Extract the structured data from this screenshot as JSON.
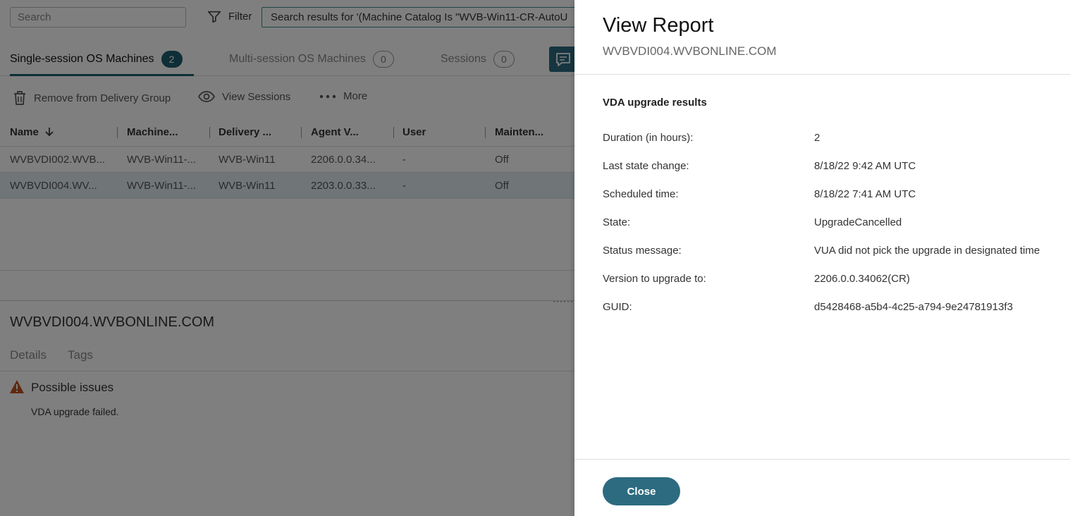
{
  "colors": {
    "accent": "#2d6b80",
    "tab_active": "#1d5e6e",
    "warning": "#c0521f",
    "row_selected": "#e0ecef"
  },
  "toolbar": {
    "search_placeholder": "Search",
    "filter_icon": "filter-icon",
    "filter_label": "Filter",
    "filter_query": "Search results for '(Machine Catalog Is \"WVB-Win11-CR-AutoU"
  },
  "tabs": [
    {
      "label": "Single-session OS Machines",
      "count": "2",
      "active": true
    },
    {
      "label": "Multi-session OS Machines",
      "count": "0",
      "active": false
    },
    {
      "label": "Sessions",
      "count": "0",
      "active": false
    }
  ],
  "actions": [
    {
      "label": "Remove from Delivery Group",
      "icon": "trash-icon"
    },
    {
      "label": "View Sessions",
      "icon": "eye-icon"
    },
    {
      "label": "More",
      "icon": "more-dots-icon"
    }
  ],
  "table": {
    "columns": [
      "Name",
      "Machine...",
      "Delivery ...",
      "Agent V...",
      "User",
      "Mainten..."
    ],
    "rows": [
      [
        "WVBVDI002.WVB...",
        "WVB-Win11-...",
        "WVB-Win11",
        "2206.0.0.34...",
        "-",
        "Off"
      ],
      [
        "WVBVDI004.WV...",
        "WVB-Win11-...",
        "WVB-Win11",
        "2203.0.0.33...",
        "-",
        "Off"
      ]
    ],
    "selected_row": 1
  },
  "detail": {
    "title": "WVBVDI004.WVBONLINE.COM",
    "tabs": [
      "Details",
      "Tags"
    ],
    "issue_title": "Possible issues",
    "issue_message": "VDA upgrade failed."
  },
  "panel": {
    "title": "View Report",
    "subtitle": "WVBVDI004.WVBONLINE.COM",
    "section_title": "VDA upgrade results",
    "fields": [
      {
        "label": "Duration (in hours):",
        "value": "2"
      },
      {
        "label": "Last state change:",
        "value": "8/18/22 9:42 AM UTC"
      },
      {
        "label": "Scheduled time:",
        "value": "8/18/22 7:41 AM UTC"
      },
      {
        "label": "State:",
        "value": "UpgradeCancelled"
      },
      {
        "label": "Status message:",
        "value": "VUA did not pick the upgrade in designated time"
      },
      {
        "label": "Version to upgrade to:",
        "value": "2206.0.0.34062(CR)"
      },
      {
        "label": "GUID:",
        "value": "d5428468-a5b4-4c25-a794-9e24781913f3"
      }
    ],
    "close_label": "Close"
  }
}
